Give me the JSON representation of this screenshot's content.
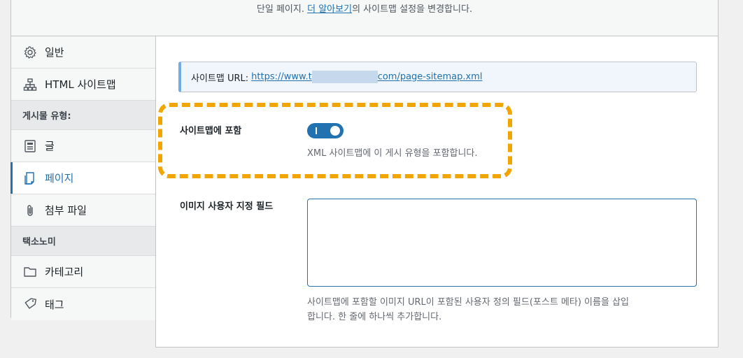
{
  "top": {
    "desc_before": "단일 페이지. ",
    "learn_more": "더 알아보기",
    "desc_after": "의 사이트맵 설정을 변경합니다."
  },
  "sidebar": {
    "items": [
      {
        "label": "일반",
        "icon": "gear-icon"
      },
      {
        "label": "HTML 사이트맵",
        "icon": "sitemap-icon"
      }
    ],
    "heading_post_types": "게시물 유형:",
    "post_types": [
      {
        "label": "글",
        "icon": "post-icon"
      },
      {
        "label": "페이지",
        "icon": "page-icon",
        "active": true
      },
      {
        "label": "첨부 파일",
        "icon": "paperclip-icon"
      }
    ],
    "heading_taxonomies": "택소노미",
    "taxonomies": [
      {
        "label": "카테고리",
        "icon": "folder-icon"
      },
      {
        "label": "태그",
        "icon": "tag-icon"
      }
    ]
  },
  "notice": {
    "label": "사이트맵 URL:",
    "url_start": "https://www.t",
    "url_end": "com/page-sitemap.xml"
  },
  "include": {
    "label": "사이트맵에 포함",
    "enabled": true,
    "description": "XML 사이트맵에 이 게시 유형을 포함합니다."
  },
  "image_fields": {
    "label": "이미지 사용자 지정 필드",
    "value": "",
    "description_line1": "사이트맵에 포함할 이미지 URL이 포함된 사용자 정의 필드(포스트 메타) 이름을 삽입",
    "description_line2": "합니다. 한 줄에 하나씩 추가합니다."
  },
  "colors": {
    "accent": "#2271b1",
    "highlight": "#f0a500"
  }
}
